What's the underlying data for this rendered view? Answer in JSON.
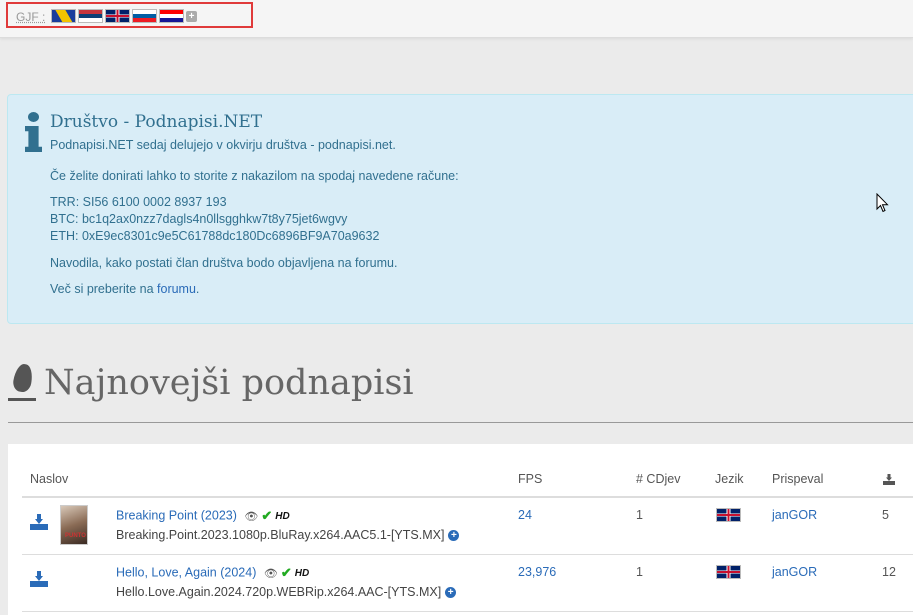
{
  "topbar": {
    "language_label": "GJF :",
    "flags": [
      "flag-bosnia-icon",
      "flag-serbia-icon",
      "flag-uk-icon",
      "flag-slovenia-icon",
      "flag-croatia-icon"
    ],
    "more_icon": "plus-icon"
  },
  "alert": {
    "title": "Društvo - Podnapisi.NET",
    "line1": "Podnapisi.NET sedaj delujejo v okvirju društva - podnapisi.net.",
    "line2": "Če želite donirati lahko to storite z nakazilom na spodaj navedene račune:",
    "trr": "TRR: SI56 6100 0002 8937 193",
    "btc": "BTC: bc1q2ax0nzz7dagls4n0llsgghkw7t8y75jet6wgvy",
    "eth": "ETH: 0xE9ec8301c9e5C61788dc180Dc6896BF9A70a9632",
    "line3": "Navodila, kako postati član društva bodo objavljena na forumu.",
    "line4_prefix": "Več si preberite na ",
    "line4_link": "forumu",
    "line4_suffix": ".",
    "accent_color": "#31708f",
    "background_color": "#d9edf7"
  },
  "section": {
    "title": "Najnovejši podnapisi",
    "icon": "fire-icon"
  },
  "table": {
    "headers": {
      "title": "Naslov",
      "fps": "FPS",
      "cds": "# CDjev",
      "language": "Jezik",
      "uploader": "Prispeval",
      "downloads_icon": "download-icon"
    },
    "rows": [
      {
        "title": "Breaking Point (2023)",
        "release": "Breaking.Point.2023.1080p.BluRay.x264.AAC5.1-[YTS.MX]",
        "fps": "24",
        "cds": "1",
        "language": "flag-uk-icon",
        "uploader": "janGOR",
        "downloads": "5",
        "hd": "HD",
        "poster_text": "PUNTO"
      },
      {
        "title": "Hello, Love, Again (2024)",
        "release": "Hello.Love.Again.2024.720p.WEBRip.x264.AAC-[YTS.MX]",
        "fps": "23,976",
        "cds": "1",
        "language": "flag-uk-icon",
        "uploader": "janGOR",
        "downloads": "12",
        "hd": "HD"
      }
    ],
    "link_color": "#2a6bb8"
  }
}
